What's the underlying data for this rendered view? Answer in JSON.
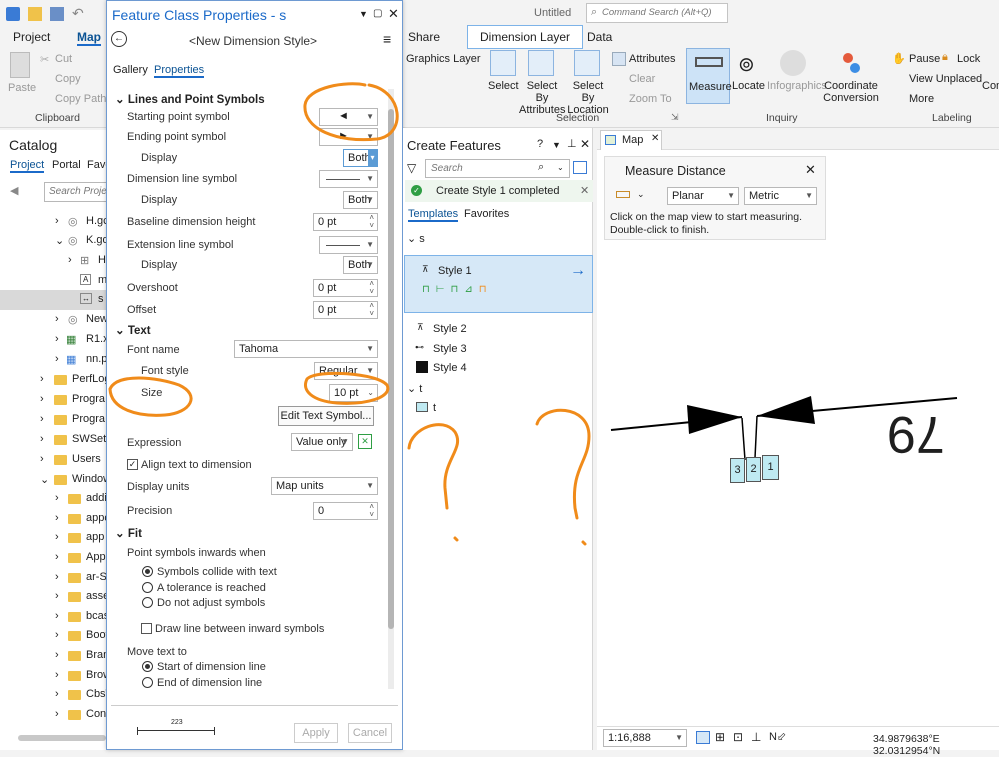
{
  "app": {
    "doc_title": "Untitled",
    "command_search_placeholder": "Command Search (Alt+Q)"
  },
  "ribbon": {
    "tabs": [
      "Project",
      "Map",
      "Share",
      "Dimension Layer",
      "Data"
    ],
    "graphics_layer": "Graphics Layer",
    "clipboard": {
      "paste": "Paste",
      "cut": "Cut",
      "copy": "Copy",
      "copy_path": "Copy Path",
      "group": "Clipboard"
    },
    "selection": {
      "select": "Select",
      "select_by_attributes": "Select By Attributes",
      "select_by_location": "Select By Location",
      "attributes": "Attributes",
      "clear": "Clear",
      "zoom_to": "Zoom To",
      "group": "Selection"
    },
    "inquiry": {
      "measure": "Measure",
      "locate": "Locate",
      "infographics": "Infographics",
      "coordinate_conversion": "Coordinate Conversion",
      "group": "Inquiry"
    },
    "labeling": {
      "pause": "Pause",
      "lock": "Lock",
      "view_unplaced": "View Unplaced",
      "more": "More",
      "con": "Con",
      "group": "Labeling"
    }
  },
  "catalog": {
    "title": "Catalog",
    "tabs": [
      "Project",
      "Portal",
      "Favo"
    ],
    "search_placeholder": "Search Project",
    "items": [
      "H.gc",
      "K.gd",
      "H",
      "m",
      "s",
      "New",
      "R1.xl",
      "nn.p",
      "PerfLog",
      "Progra",
      "Progra",
      "SWSetu",
      "Users",
      "Window",
      "addi",
      "appc",
      "app",
      "App",
      "ar-S/",
      "asse",
      "bcas",
      "Boot",
      "Bran",
      "Brow",
      "CbsT",
      "Cont"
    ]
  },
  "dialog": {
    "title": "Feature Class Properties - s",
    "style_name": "<New Dimension Style>",
    "tabs": [
      "Gallery",
      "Properties"
    ],
    "sections": {
      "lines": "Lines and Point Symbols",
      "text": "Text",
      "fit": "Fit"
    },
    "labels": {
      "starting_point": "Starting point symbol",
      "ending_point": "Ending point symbol",
      "display": "Display",
      "dimension_line": "Dimension line symbol",
      "baseline_height": "Baseline dimension height",
      "extension_line": "Extension line symbol",
      "overshoot": "Overshoot",
      "offset": "Offset",
      "font_name": "Font name",
      "font_style": "Font style",
      "size": "Size",
      "edit_text_symbol": "Edit Text Symbol...",
      "expression": "Expression",
      "align_text": "Align text to dimension",
      "display_units": "Display units",
      "precision": "Precision",
      "point_symbols_inwards": "Point symbols inwards when",
      "draw_line_between": "Draw line between inward symbols",
      "move_text_to": "Move text to"
    },
    "values": {
      "display_1": "Both",
      "display_2": "Both",
      "display_3": "Both",
      "baseline_height": "0 pt",
      "overshoot": "0 pt",
      "offset": "0 pt",
      "font_name": "Tahoma",
      "font_style": "Regular",
      "size": "10 pt",
      "expression": "Value only",
      "display_units": "Map units",
      "precision": "0"
    },
    "fit_options": [
      "Symbols collide with text",
      "A tolerance is reached",
      "Do not adjust symbols"
    ],
    "move_options": [
      "Start of dimension line",
      "End of dimension line"
    ],
    "preview_value": "223",
    "apply": "Apply",
    "cancel": "Cancel"
  },
  "create_features": {
    "title": "Create Features",
    "search_placeholder": "Search",
    "status": "Create Style 1 completed",
    "tabs": [
      "Templates",
      "Favorites"
    ],
    "layer_s": "s",
    "selected_template": "Style 1",
    "templates": [
      "Style 2",
      "Style 3",
      "Style 4"
    ],
    "layer_t": "t",
    "template_t": "t"
  },
  "map": {
    "tab": "Map",
    "measure": {
      "title": "Measure Distance",
      "mode": "Planar",
      "units": "Metric",
      "instructions_1": "Click on the map view to start measuring.",
      "instructions_2": "Double-click to finish."
    },
    "dimension_text": "79",
    "boxes": [
      "3",
      "2",
      "1"
    ],
    "scale": "1:16,888",
    "coordinates": "34.9879638°E 32.0312954°N"
  },
  "colors": {
    "accent": "#1b6ac9",
    "annotation": "#f08b1a",
    "selected_row": "#d6e8f7",
    "success": "#2f9e44"
  }
}
